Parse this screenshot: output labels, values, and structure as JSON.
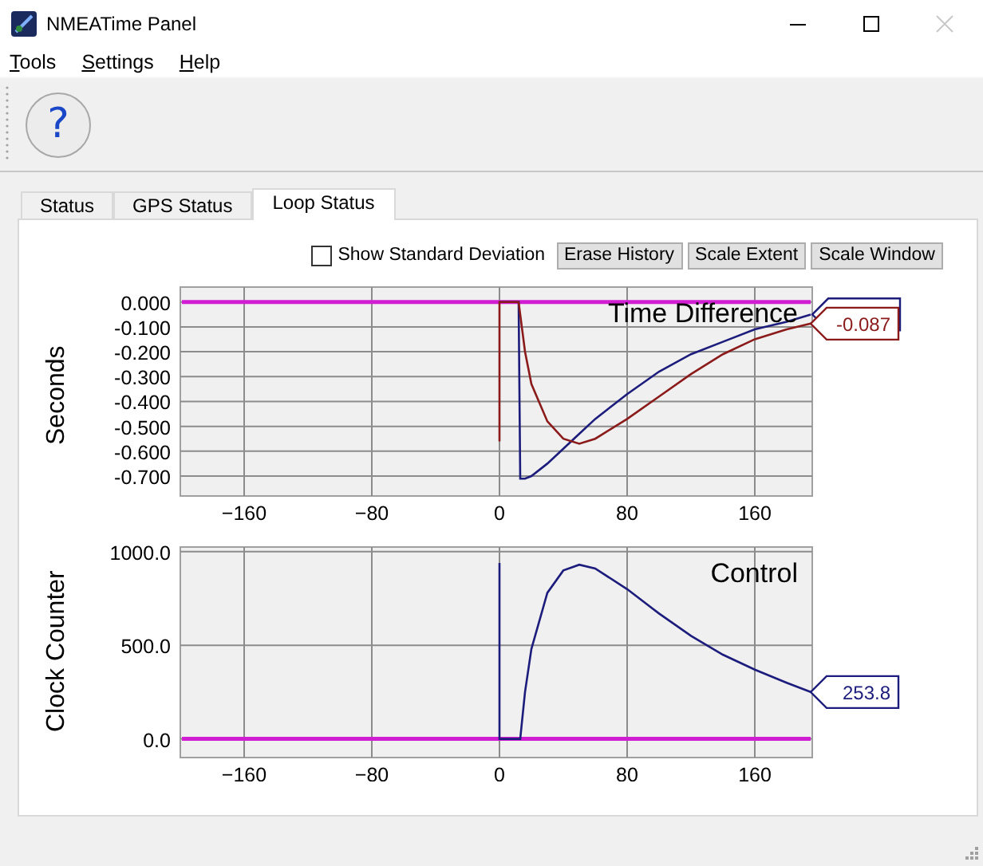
{
  "window": {
    "title": "NMEATime Panel"
  },
  "menu": [
    {
      "label": "Tools",
      "mnemonic": true
    },
    {
      "label": "Settings",
      "mnemonic": true
    },
    {
      "label": "Help",
      "mnemonic": true
    }
  ],
  "toolbar": {
    "help_button": "?"
  },
  "tabs": [
    {
      "label": "Status",
      "selected": false
    },
    {
      "label": "GPS Status",
      "selected": false
    },
    {
      "label": "Loop Status",
      "selected": true
    }
  ],
  "loop_status": {
    "show_standard_deviation": {
      "label": "Show Standard Deviation",
      "checked": false
    },
    "buttons": [
      "Erase History",
      "Scale Extent",
      "Scale Window"
    ],
    "charts": [
      {
        "chart_data": {
          "type": "line",
          "title": "Time Difference",
          "ylabel": "Seconds",
          "x": [
            0,
            0,
            12,
            13,
            16,
            20,
            30,
            40,
            50,
            60,
            80,
            100,
            120,
            140,
            160,
            180,
            195
          ],
          "series": [
            {
              "color": "#1c1c7c",
              "values": [
                0,
                0,
                0,
                -0.71,
                -0.71,
                -0.7,
                -0.65,
                -0.59,
                -0.53,
                -0.47,
                -0.37,
                -0.28,
                -0.21,
                -0.16,
                -0.11,
                -0.08,
                -0.05
              ]
            },
            {
              "color": "#8b1a1a",
              "values": [
                -0.56,
                0,
                0,
                -0.05,
                -0.2,
                -0.33,
                -0.48,
                -0.55,
                -0.57,
                -0.55,
                -0.47,
                -0.38,
                -0.29,
                -0.21,
                -0.15,
                -0.11,
                -0.087
              ]
            }
          ],
          "xlim": [
            -200,
            196
          ],
          "ylim": [
            -0.78,
            0.06
          ],
          "xticks": [
            -160,
            -80,
            0,
            80,
            160
          ],
          "yticks": [
            {
              "value": 0,
              "label": "0.000"
            },
            {
              "value": -0.1,
              "label": "-0.100"
            },
            {
              "value": -0.2,
              "label": "-0.200"
            },
            {
              "value": -0.3,
              "label": "-0.300"
            },
            {
              "value": -0.4,
              "label": "-0.400"
            },
            {
              "value": -0.5,
              "label": "-0.500"
            },
            {
              "value": -0.6,
              "label": "-0.600"
            },
            {
              "value": -0.7,
              "label": "-0.700"
            }
          ],
          "grid": true,
          "ref_lines": [
            {
              "axis": "y",
              "value": 0,
              "color": "#d21ed2"
            }
          ],
          "annotations": [
            {
              "text": "-0.087",
              "x": 195,
              "y": -0.087
            }
          ]
        }
      },
      {
        "chart_data": {
          "type": "line",
          "title": "Control",
          "ylabel": "Clock Counter",
          "x": [
            0,
            0,
            12,
            13,
            16,
            20,
            30,
            40,
            50,
            60,
            80,
            100,
            120,
            140,
            160,
            180,
            195
          ],
          "series": [
            {
              "color": "#1c1c7c",
              "values": [
                940,
                0,
                0,
                0,
                250,
                480,
                780,
                900,
                930,
                910,
                800,
                670,
                550,
                450,
                370,
                300,
                250
              ]
            }
          ],
          "xlim": [
            -200,
            196
          ],
          "ylim": [
            -100,
            1025
          ],
          "xticks": [
            -160,
            -80,
            0,
            80,
            160
          ],
          "yticks": [
            {
              "value": 0,
              "label": "0.0"
            },
            {
              "value": 500,
              "label": "500.0"
            },
            {
              "value": 1000,
              "label": "1000.0"
            }
          ],
          "grid": true,
          "ref_lines": [
            {
              "axis": "y",
              "value": 0,
              "color": "#d21ed2"
            }
          ],
          "annotations": [
            {
              "text": "253.8",
              "x": 195,
              "y": 250
            }
          ]
        }
      }
    ]
  }
}
